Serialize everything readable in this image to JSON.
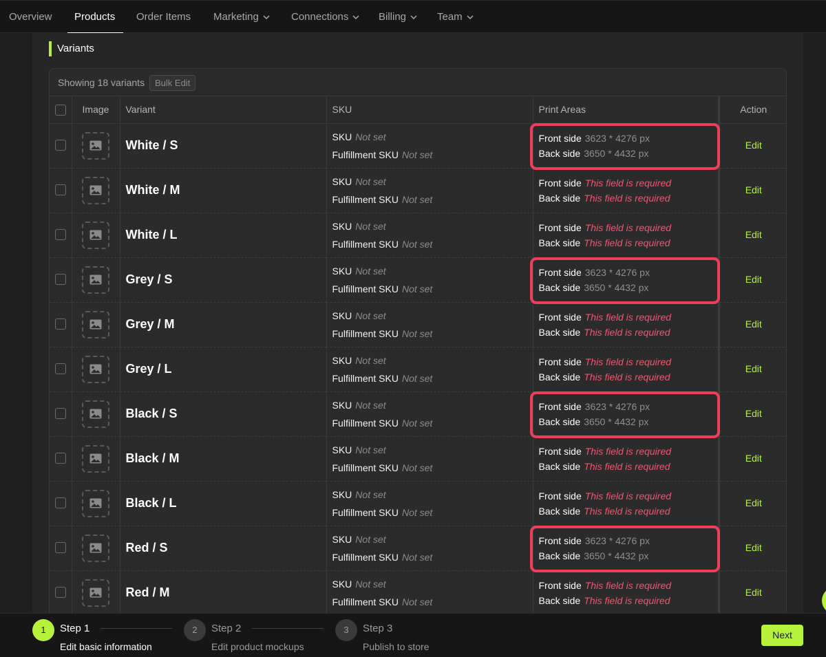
{
  "nav": {
    "items": [
      {
        "label": "Overview",
        "dropdown": false,
        "active": false
      },
      {
        "label": "Products",
        "dropdown": false,
        "active": true
      },
      {
        "label": "Order Items",
        "dropdown": false,
        "active": false
      },
      {
        "label": "Marketing",
        "dropdown": true,
        "active": false
      },
      {
        "label": "Connections",
        "dropdown": true,
        "active": false
      },
      {
        "label": "Billing",
        "dropdown": true,
        "active": false
      },
      {
        "label": "Team",
        "dropdown": true,
        "active": false
      }
    ]
  },
  "section": {
    "title": "Variants"
  },
  "table": {
    "showing": "Showing 18 variants",
    "bulk_edit": "Bulk Edit",
    "columns": {
      "image": "Image",
      "variant": "Variant",
      "sku": "SKU",
      "print": "Print Areas",
      "action": "Action"
    },
    "labels": {
      "sku": "SKU",
      "fulfillment": "Fulfillment SKU",
      "not_set": "Not set",
      "front": "Front side",
      "back": "Back side",
      "edit": "Edit"
    },
    "rows": [
      {
        "variant": "White / S",
        "front": "3623 * 4276 px",
        "back": "3650 * 4432 px",
        "highlight": true
      },
      {
        "variant": "White / M",
        "front": "This field is required",
        "back": "This field is required",
        "highlight": false
      },
      {
        "variant": "White / L",
        "front": "This field is required",
        "back": "This field is required",
        "highlight": false
      },
      {
        "variant": "Grey / S",
        "front": "3623 * 4276 px",
        "back": "3650 * 4432 px",
        "highlight": true
      },
      {
        "variant": "Grey / M",
        "front": "This field is required",
        "back": "This field is required",
        "highlight": false
      },
      {
        "variant": "Grey / L",
        "front": "This field is required",
        "back": "This field is required",
        "highlight": false
      },
      {
        "variant": "Black / S",
        "front": "3623 * 4276 px",
        "back": "3650 * 4432 px",
        "highlight": true
      },
      {
        "variant": "Black / M",
        "front": "This field is required",
        "back": "This field is required",
        "highlight": false
      },
      {
        "variant": "Black / L",
        "front": "This field is required",
        "back": "This field is required",
        "highlight": false
      },
      {
        "variant": "Red / S",
        "front": "3623 * 4276 px",
        "back": "3650 * 4432 px",
        "highlight": true
      },
      {
        "variant": "Red / M",
        "front": "This field is required",
        "back": "This field is required",
        "highlight": false
      }
    ]
  },
  "stepper": {
    "steps": [
      {
        "number": "1",
        "title": "Step 1",
        "desc": "Edit basic information",
        "active": true
      },
      {
        "number": "2",
        "title": "Step 2",
        "desc": "Edit product mockups",
        "active": false
      },
      {
        "number": "3",
        "title": "Step 3",
        "desc": "Publish to store",
        "active": false
      }
    ],
    "next": "Next"
  },
  "colors": {
    "accent": "#b6f23b",
    "error": "#f0566f",
    "highlight": "#ee3e5c",
    "background": "#1e1e1e"
  },
  "icons": {
    "image_placeholder": "image-icon",
    "dropdown": "chevron-down-icon"
  }
}
